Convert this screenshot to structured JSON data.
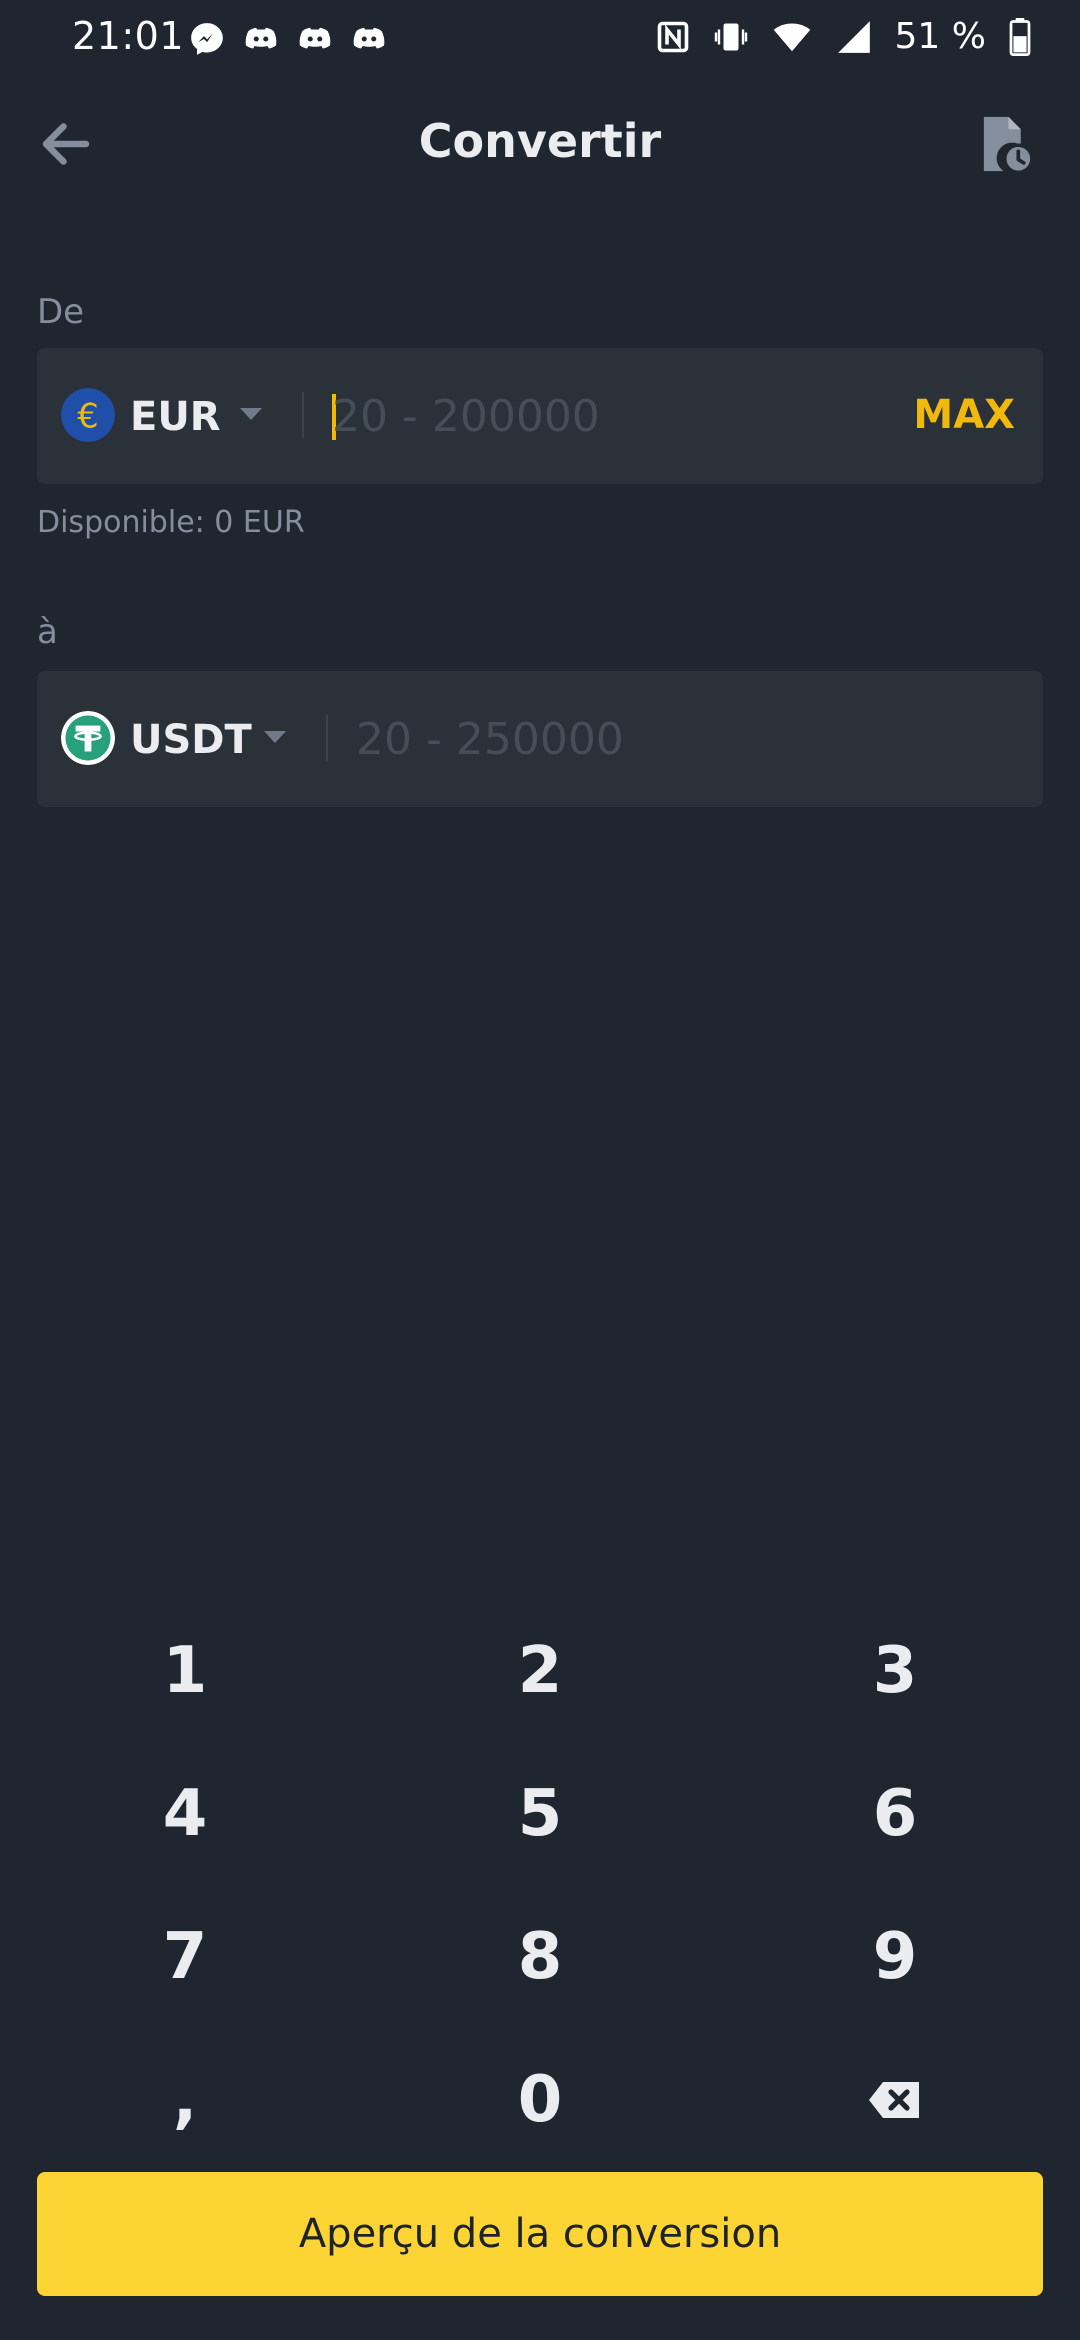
{
  "status_bar": {
    "time": "21:01",
    "notification_icons": [
      "messenger-icon",
      "discord-icon",
      "discord-icon",
      "discord-icon"
    ],
    "system_icons": [
      "nfc-icon",
      "vibrate-icon",
      "wifi-icon",
      "signal-icon",
      "battery-icon"
    ],
    "battery_percent": "51 %"
  },
  "header": {
    "title": "Convertir",
    "back_icon": "arrow-left-icon",
    "history_icon": "order-history-icon"
  },
  "from": {
    "label": "De",
    "currency": "EUR",
    "currency_icon": "euro-coin-icon",
    "amount_value": "",
    "placeholder": "20 - 200000",
    "max_label": "MAX",
    "available": "Disponible: 0 EUR"
  },
  "to": {
    "label": "à",
    "currency": "USDT",
    "currency_icon": "tether-coin-icon",
    "amount_value": "",
    "placeholder": "20 - 250000"
  },
  "keypad": {
    "keys": [
      "1",
      "2",
      "3",
      "4",
      "5",
      "6",
      "7",
      "8",
      "9",
      ",",
      "0"
    ],
    "backspace_icon": "backspace-icon"
  },
  "cta": {
    "label": "Aperçu de la conversion"
  },
  "colors": {
    "background": "#1f2630",
    "field": "#2b3139",
    "accent": "#f0b90b",
    "button": "#fcd535",
    "muted": "#848e9c",
    "tether": "#26a17b",
    "euro": "#1f4fa8"
  }
}
